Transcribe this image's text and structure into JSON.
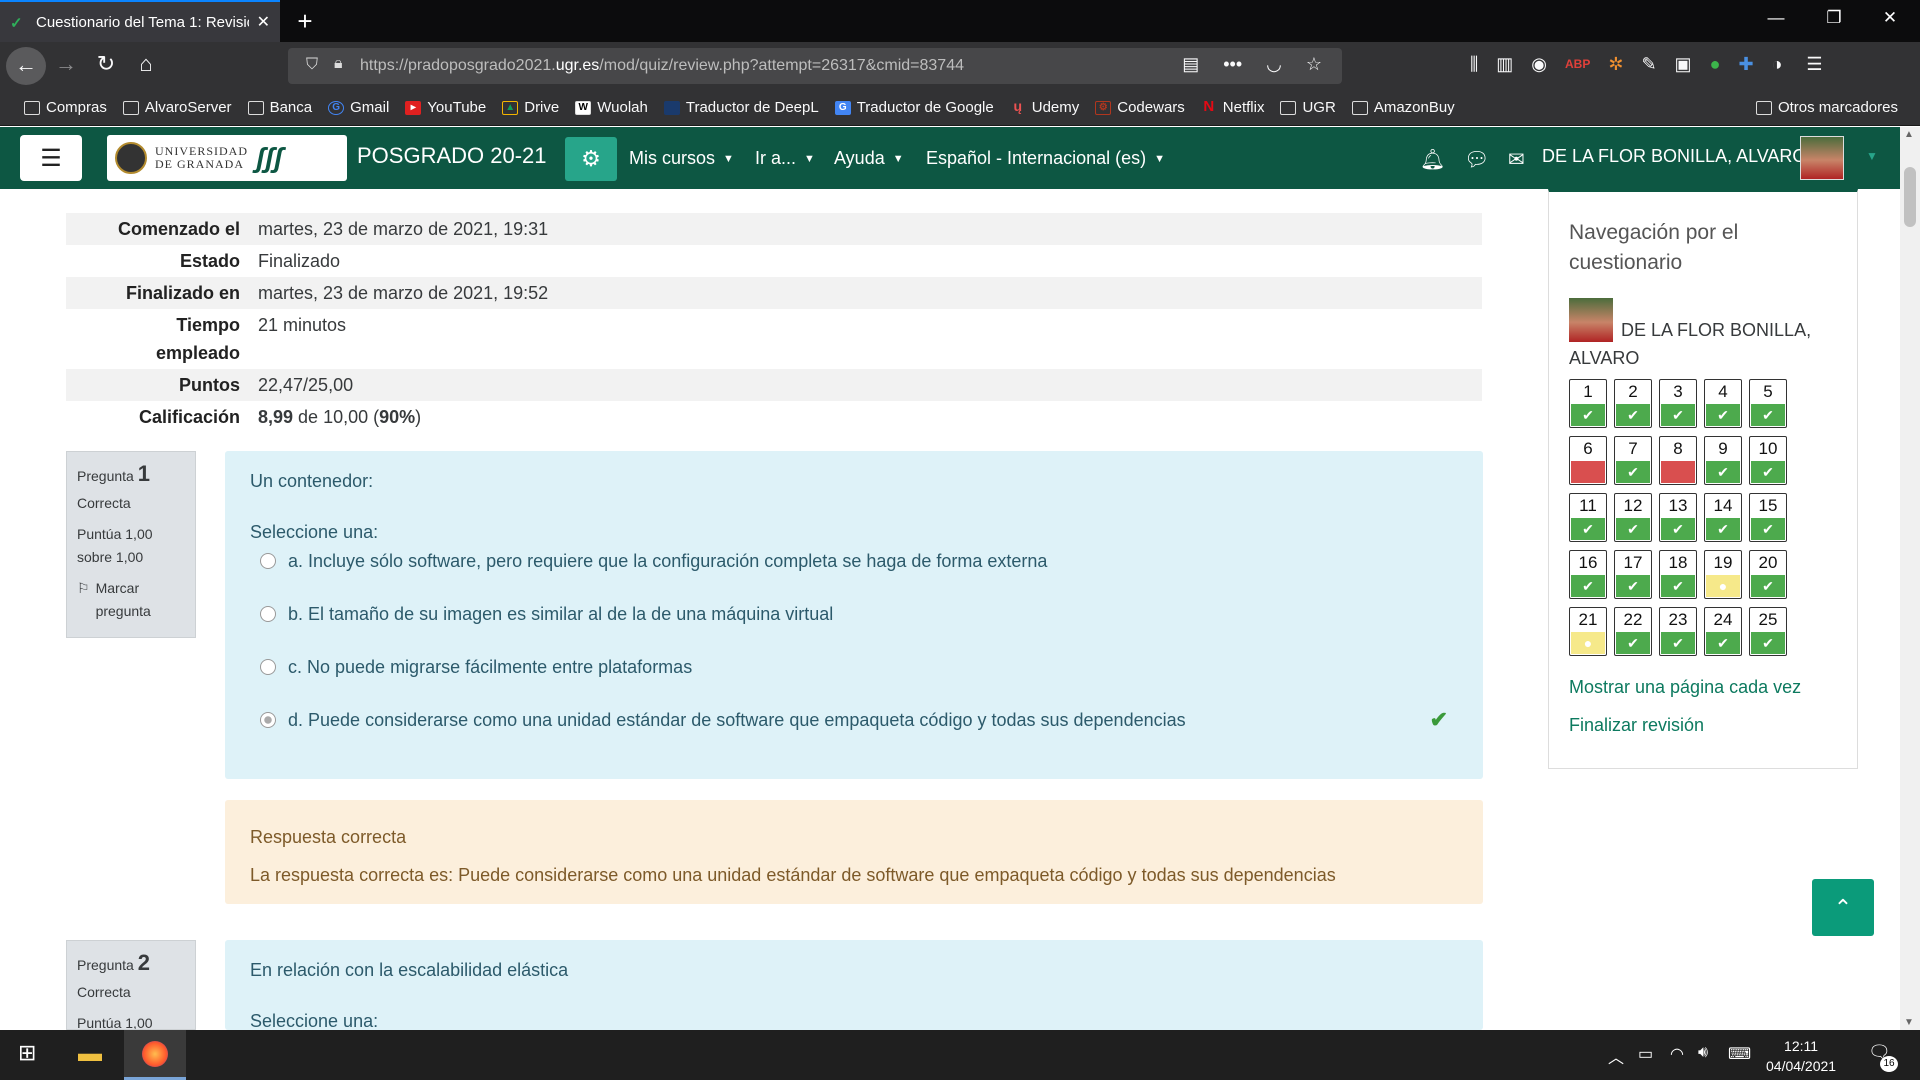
{
  "browser": {
    "tab_title": "Cuestionario del Tema 1: Revisió",
    "url_prefix": "https://pradoposgrado2021.",
    "url_host": "ugr.es",
    "url_path": "/mod/quiz/review.php?attempt=26317&cmid=83744",
    "bookmarks": [
      "Compras",
      "AlvaroServer",
      "Banca",
      "Gmail",
      "YouTube",
      "Drive",
      "Wuolah",
      "Traductor de DeepL",
      "Traductor de Google",
      "Udemy",
      "Codewars",
      "Netflix",
      "UGR",
      "AmazonBuy"
    ],
    "other_bookmarks": "Otros marcadores"
  },
  "header": {
    "logo_text_1": "UNIVERSIDAD",
    "logo_text_2": "DE GRANADA",
    "site_name": "POSGRADO 20-21",
    "menu": [
      "Mis cursos",
      "Ir a...",
      "Ayuda",
      "Español - Internacional (es)"
    ],
    "user_name": "DE LA FLOR BONILLA, ALVARO"
  },
  "summary": [
    {
      "label": "Comenzado el",
      "value": "martes, 23 de marzo de 2021, 19:31"
    },
    {
      "label": "Estado",
      "value": "Finalizado"
    },
    {
      "label": "Finalizado en",
      "value": "martes, 23 de marzo de 2021, 19:52"
    },
    {
      "label": "Tiempo empleado",
      "value": "21 minutos"
    },
    {
      "label": "Puntos",
      "value": "22,47/25,00"
    },
    {
      "label": "Calificación",
      "grade": "8,99",
      "of": " de 10,00 (",
      "percent": "90%",
      "close": ")"
    }
  ],
  "question1": {
    "label": "Pregunta",
    "number": "1",
    "state": "Correcta",
    "score_1": "Puntúa 1,00",
    "score_2": "sobre 1,00",
    "flag": "Marcar pregunta",
    "text": "Un contenedor:",
    "prompt": "Seleccione una:",
    "options": [
      "a. Incluye sólo software, pero requiere que la configuración completa se haga de forma externa",
      "b. El tamaño de su imagen es similar al de la de una máquina virtual",
      "c. No puede migrarse fácilmente entre plataformas",
      "d. Puede considerarse como una unidad estándar de software que empaqueta código y todas sus dependencias"
    ],
    "selected_index": 3,
    "feedback_title": "Respuesta correcta",
    "feedback_text": "La respuesta correcta es: Puede considerarse como una unidad estándar de software que empaqueta código y todas sus dependencias"
  },
  "question2": {
    "label": "Pregunta",
    "number": "2",
    "state": "Correcta",
    "score_1": "Puntúa 1,00",
    "text": "En relación con la escalabilidad elástica",
    "prompt": "Seleccione una:"
  },
  "quiz_nav": {
    "title": "Navegación por el cuestionario",
    "user": "DE LA FLOR BONILLA, ALVARO",
    "states": [
      "ok",
      "ok",
      "ok",
      "ok",
      "ok",
      "bad",
      "ok",
      "bad",
      "ok",
      "ok",
      "ok",
      "ok",
      "ok",
      "ok",
      "ok",
      "ok",
      "ok",
      "ok",
      "part",
      "ok",
      "part",
      "ok",
      "ok",
      "ok",
      "ok"
    ],
    "show_one_page": "Mostrar una página cada vez",
    "finish_review": "Finalizar revisión"
  },
  "taskbar": {
    "time": "12:11",
    "date": "04/04/2021",
    "notifications": "16"
  },
  "colors": {
    "header": "#0d5743",
    "accent": "#27a58a",
    "question_bg": "#def2f8",
    "feedback_bg": "#fcefdc",
    "correct": "#4daa4d",
    "incorrect": "#d94f4f",
    "partial": "#f6e98a"
  }
}
